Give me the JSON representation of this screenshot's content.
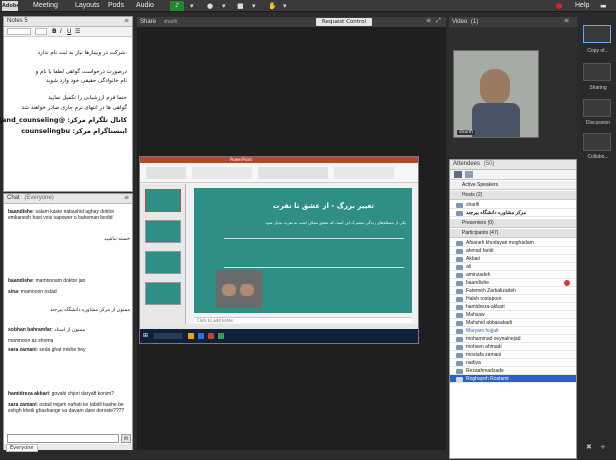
{
  "topbar": {
    "logo": "Adobe",
    "menus": [
      "Meeting",
      "Layouts",
      "Pods",
      "Audio"
    ],
    "help": "Help"
  },
  "notes": {
    "title": "Notes 5",
    "lines": [
      ".شرکت در وبینارها نیاز به ثبت نام ندارد",
      "درصورت درخواست گواهی لطفا با نام و",
      "نام خانوادگی حقیقی خود وارد شوید",
      "حتما فرم ارزشیابی را تکمیل نمایید",
      "گواهی ها در انتهای ترم جاری صادر خواهند شد",
      "کانال تلگرام مرکز: @birjand_counseling",
      "اینستاگرام مرکز: counselingbu"
    ]
  },
  "chat": {
    "title": "Chat",
    "scope": "(Everyone)",
    "messages": [
      {
        "name": "baandishe",
        "text": "salam kaste nabashid aghay doktor emkanesh hast vois vapower o baheman bedid"
      },
      {
        "name": "",
        "text": "خسته نباشید"
      },
      {
        "name": "baandishe",
        "text": "mamnonam doktor jan"
      },
      {
        "name": "sina",
        "text": "mamnoon ostad"
      },
      {
        "name": "",
        "text": "ممنون از مرکز مشاوره دانشگاه بیرجند"
      },
      {
        "name": "sobhan bahramfar",
        "text": "ممنون از استاد"
      },
      {
        "name": "",
        "text": "mamnoon az shoma"
      },
      {
        "name": "sara zamani",
        "text": "seda ghat mishe hey"
      },
      {
        "name": "hamidreza akbari",
        "text": "govahi chjori daryaft konim?"
      },
      {
        "name": "sara zamani",
        "text": "ostad mijam nafrati ke tabdil bashe be eshgh kheili ghashange va davam dare doroste????"
      }
    ],
    "footer_tab": "Everyone"
  },
  "share": {
    "title": "Share",
    "presenter": "sharifi",
    "request_control": "Request Control"
  },
  "slide": {
    "title": "تغییر بزرگ - از عشق تا نفرت",
    "body": "یکی از مسئله‌های زندگی مشترک این است که عشق ممکن است به نفرت تبدیل شود",
    "notes_placeholder": "Click to add notes",
    "window_title": "PowerPoint",
    "thumbs": [
      "1",
      "2",
      "3",
      "4"
    ]
  },
  "video": {
    "title": "Video",
    "count": "(1)",
    "name": "sharifi"
  },
  "attendees": {
    "title": "Attendees",
    "count": "(50)",
    "active_speakers": "Active Speakers",
    "hosts_label": "Hosts (2)",
    "hosts": [
      "sharifi",
      "مرکز مشاوره دانشگاه بیرجند"
    ],
    "presenters_label": "Presenters (0)",
    "participants_label": "Participants (47)",
    "participants": [
      "Afsaneh khodayari moghadam",
      "ahmad faridi",
      "Akbari",
      "ali",
      "aminzadeh",
      "baandishe",
      "Fatemeh Zarbalizadeh",
      "Haleh rostapoor",
      "hamidreza-akbari",
      "Mahsaw",
      "Mahshid abbasabadi",
      "Maryam hojjati",
      "mohammad zeynalnejad",
      "mohsen ahmadi",
      "mostafa zamani",
      "nadiya",
      "Rezaahmadzade",
      "Roghayeh Rostami"
    ]
  },
  "rail": {
    "items": [
      "Copy of...",
      "Sharing",
      "Discussion",
      "Collabo..."
    ]
  },
  "colors": {
    "slide_bg": "#2f8f86",
    "slide_title": "#ffffff",
    "slide_accent": "#e7522a",
    "selected_row": "#2a63c6"
  }
}
